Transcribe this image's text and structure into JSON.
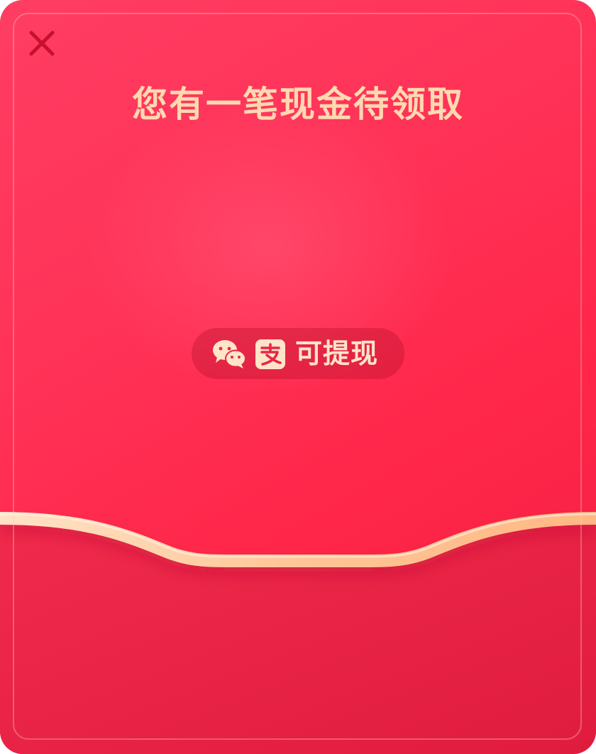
{
  "dialog": {
    "title": "您有一笔现金待领取",
    "withdraw_label": "可提现",
    "close_icon": "close-icon",
    "payment_icons": [
      "wechat-icon",
      "alipay-icon"
    ]
  },
  "colors": {
    "background": "#ff2a4f",
    "pocket": "#ec2245",
    "title_text": "#ffd9b0",
    "band": "#ffc596",
    "close": "#c8102e"
  }
}
